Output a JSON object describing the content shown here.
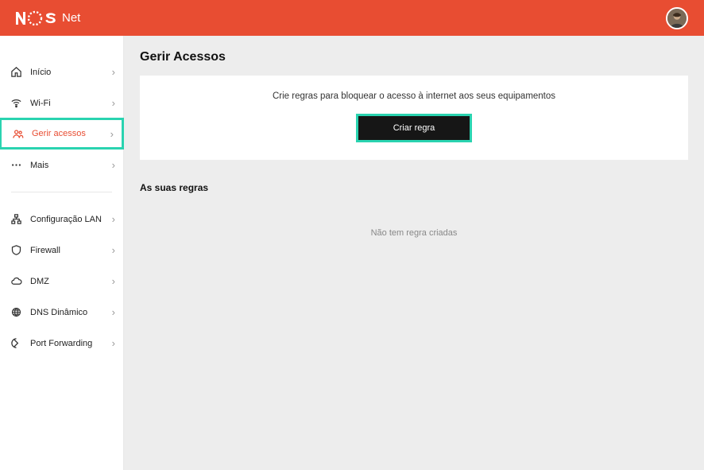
{
  "brand": {
    "product": "Net"
  },
  "sidebar": {
    "items": [
      {
        "label": "Início",
        "icon": "home-icon"
      },
      {
        "label": "Wi-Fi",
        "icon": "wifi-icon"
      },
      {
        "label": "Gerir acessos",
        "icon": "users-icon"
      },
      {
        "label": "Mais",
        "icon": "more-icon"
      },
      {
        "label": "Configuração LAN",
        "icon": "lan-icon"
      },
      {
        "label": "Firewall",
        "icon": "shield-icon"
      },
      {
        "label": "DMZ",
        "icon": "cloud-icon"
      },
      {
        "label": "DNS Dinâmico",
        "icon": "globe-icon"
      },
      {
        "label": "Port Forwarding",
        "icon": "forward-icon"
      }
    ]
  },
  "page": {
    "title": "Gerir Acessos",
    "card_text": "Crie regras para bloquear o acesso à internet aos seus equipamentos",
    "create_button": "Criar regra",
    "rules_title": "As suas regras",
    "empty_text": "Não tem regra criadas"
  }
}
